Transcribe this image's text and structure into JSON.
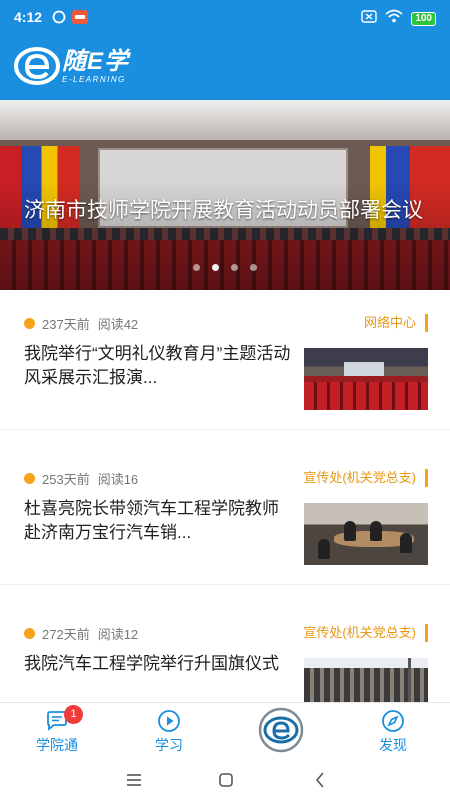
{
  "status_bar": {
    "time": "4:12",
    "battery": "100"
  },
  "header": {
    "app_name": "随E学",
    "app_subtitle": "E-LEARNING",
    "brand_color": "#1a8fe0"
  },
  "banner": {
    "caption": "济南市技师学院开展教育活动动员部署会议",
    "slide_count": 4,
    "active_slide": 2
  },
  "news": [
    {
      "days_ago": "237天前",
      "reads": "阅读42",
      "department": "网络中心",
      "title": "我院举行“文明礼仪教育月”主题活动风采展示汇报演..."
    },
    {
      "days_ago": "253天前",
      "reads": "阅读16",
      "department": "宣传处(机关党总支)",
      "title": "杜喜亮院长带领汽车工程学院教师赴济南万宝行汽车销..."
    },
    {
      "days_ago": "272天前",
      "reads": "阅读12",
      "department": "宣传处(机关党总支)",
      "title": "我院汽车工程学院举行升国旗仪式"
    }
  ],
  "tabbar": {
    "college": {
      "label": "学院通",
      "badge": "1",
      "icon": "chat-bubble-icon"
    },
    "study": {
      "label": "学习",
      "icon": "play-circle-icon"
    },
    "home": {
      "icon": "e-logo-icon"
    },
    "discover": {
      "label": "发现",
      "icon": "compass-icon"
    }
  },
  "colors": {
    "accent": "#1a8fe0",
    "tag": "#f4a31b",
    "badge": "#f03b3b"
  }
}
